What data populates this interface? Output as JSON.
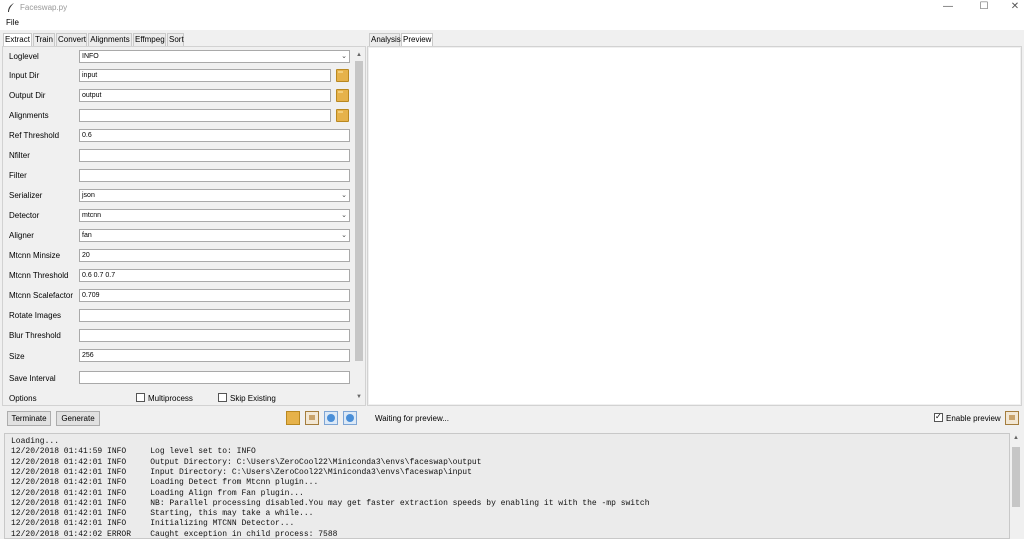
{
  "window": {
    "title": "Faceswap.py",
    "min_glyph": "—",
    "max_glyph": "☐",
    "close_glyph": "✕"
  },
  "menu": {
    "file": "File"
  },
  "left_tabs": [
    "Extract",
    "Train",
    "Convert",
    "Alignments",
    "Effmpeg",
    "Sort"
  ],
  "right_tabs": [
    "Analysis",
    "Preview"
  ],
  "fields": {
    "loglevel": {
      "label": "Loglevel",
      "value": "INFO"
    },
    "input_dir": {
      "label": "Input Dir",
      "value": "input"
    },
    "output_dir": {
      "label": "Output Dir",
      "value": "output"
    },
    "alignments": {
      "label": "Alignments",
      "value": ""
    },
    "ref_threshold": {
      "label": "Ref Threshold",
      "value": "0.6"
    },
    "nfilter": {
      "label": "Nfilter",
      "value": ""
    },
    "filter": {
      "label": "Filter",
      "value": ""
    },
    "serializer": {
      "label": "Serializer",
      "value": "json"
    },
    "detector": {
      "label": "Detector",
      "value": "mtcnn"
    },
    "aligner": {
      "label": "Aligner",
      "value": "fan"
    },
    "mtcnn_minsize": {
      "label": "Mtcnn Minsize",
      "value": "20"
    },
    "mtcnn_threshold": {
      "label": "Mtcnn Threshold",
      "value": "0.6 0.7 0.7"
    },
    "mtcnn_scalefactor": {
      "label": "Mtcnn Scalefactor",
      "value": "0.709"
    },
    "rotate_images": {
      "label": "Rotate Images",
      "value": ""
    },
    "blur_threshold": {
      "label": "Blur Threshold",
      "value": ""
    },
    "size": {
      "label": "Size",
      "value": "256"
    },
    "save_interval": {
      "label": "Save Interval",
      "value": ""
    }
  },
  "options": {
    "label": "Options",
    "multiprocess": "Multiprocess",
    "skip_existing": "Skip Existing"
  },
  "buttons": {
    "terminate": "Terminate",
    "generate": "Generate"
  },
  "preview": {
    "status": "Waiting for preview...",
    "enable_label": "Enable preview",
    "enable_checked": true
  },
  "console_lines": [
    "Loading...",
    "12/20/2018 01:41:59 INFO     Log level set to: INFO",
    "12/20/2018 01:42:01 INFO     Output Directory: C:\\Users\\ZeroCool22\\Miniconda3\\envs\\faceswap\\output",
    "12/20/2018 01:42:01 INFO     Input Directory: C:\\Users\\ZeroCool22\\Miniconda3\\envs\\faceswap\\input",
    "12/20/2018 01:42:01 INFO     Loading Detect from Mtcnn plugin...",
    "12/20/2018 01:42:01 INFO     Loading Align from Fan plugin...",
    "12/20/2018 01:42:01 INFO     NB: Parallel processing disabled.You may get faster extraction speeds by enabling it with the -mp switch",
    "12/20/2018 01:42:01 INFO     Starting, this may take a while...",
    "12/20/2018 01:42:01 INFO     Initializing MTCNN Detector...",
    "12/20/2018 01:42:02 ERROR    Caught exception in child process: 7588"
  ]
}
